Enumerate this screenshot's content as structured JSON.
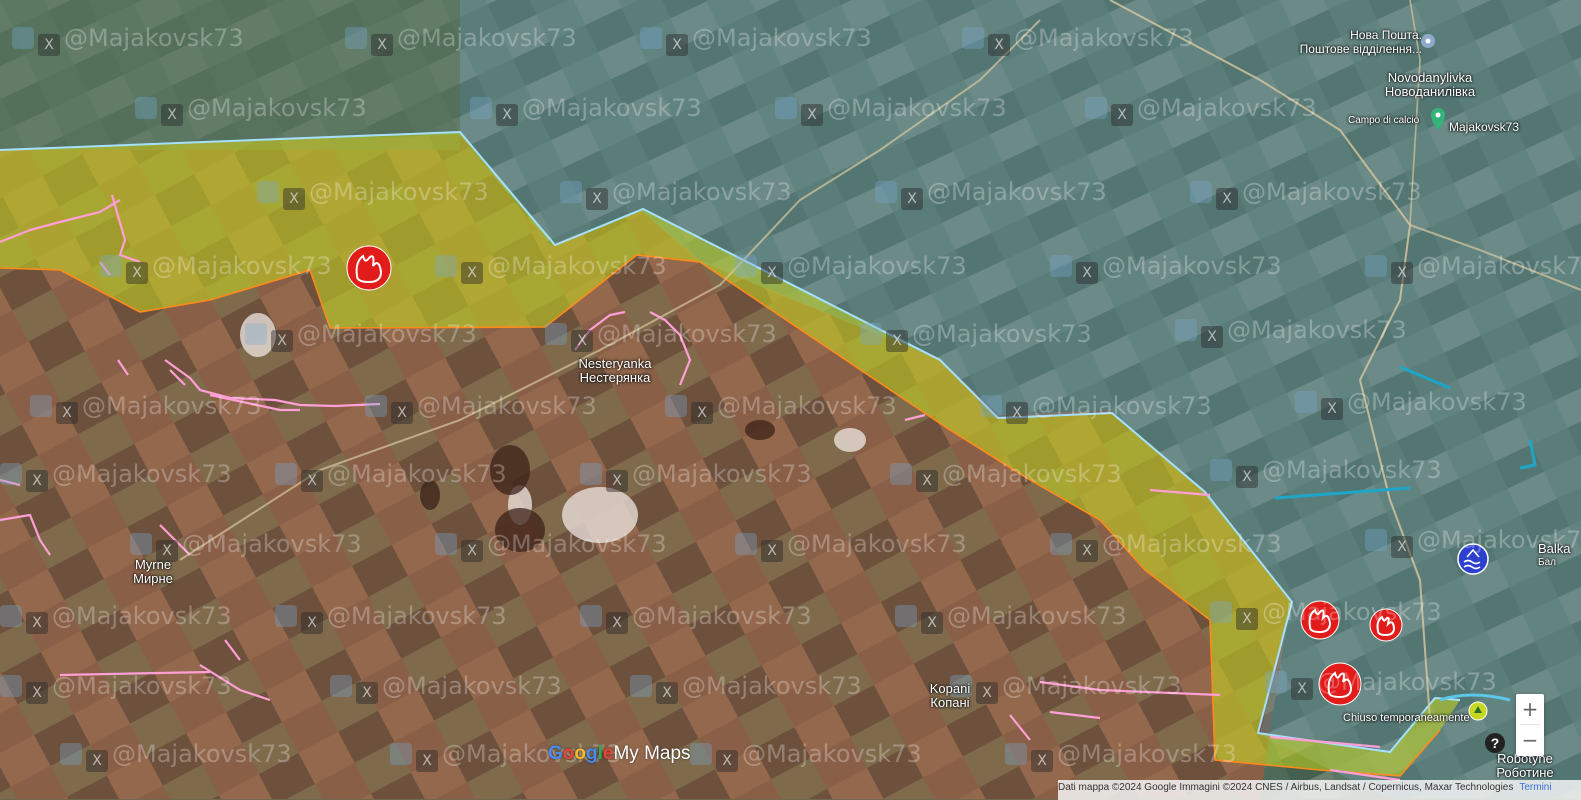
{
  "places": [
    {
      "id": "nesteryanka",
      "latin": "Nesteryanka",
      "cyrillic": "Нестерянка"
    },
    {
      "id": "myrne",
      "latin": "Myrne",
      "cyrillic": "Мирне"
    },
    {
      "id": "kopani",
      "latin": "Kopani",
      "cyrillic": "Копані"
    },
    {
      "id": "novodanylivka",
      "latin": "Novodanylivka",
      "cyrillic": "Новоданилівка"
    },
    {
      "id": "robotyne",
      "latin": "Robotyne",
      "cyrillic": "Роботине"
    },
    {
      "id": "balka",
      "latin": "Balka",
      "cyrillic": "Бал"
    }
  ],
  "pois": {
    "nova_poshta": {
      "line1": "Нова Пошта.",
      "line2": "Поштове відділення..."
    },
    "campo": "Campo di calcio",
    "majakovsk_pin": "Majakovsk73",
    "chiuso": "Chiuso temporaneamente"
  },
  "watermark": "@Majakovsk73",
  "logo": {
    "part1": "G",
    "part2": "o",
    "part3": "o",
    "part4": "g",
    "part5": "l",
    "part6": "e",
    "suffix": "My Maps"
  },
  "footer": {
    "attribution": "Dati mappa ©2024 Google Immagini ©2024 CNES / Airbus, Landsat / Copernicus, Maxar Technologies",
    "terms": "Termini"
  },
  "controls": {
    "zoom_in": "+",
    "zoom_out": "−",
    "help": "?"
  },
  "colors": {
    "ru_controlled": "#c8d820",
    "front_line": "#ff8a1a",
    "ua_line": "#a6e0ff",
    "trenches": "#ff9fd6",
    "ua_positions": "#1ea6c8",
    "fire_icon": "#e21b1b"
  }
}
